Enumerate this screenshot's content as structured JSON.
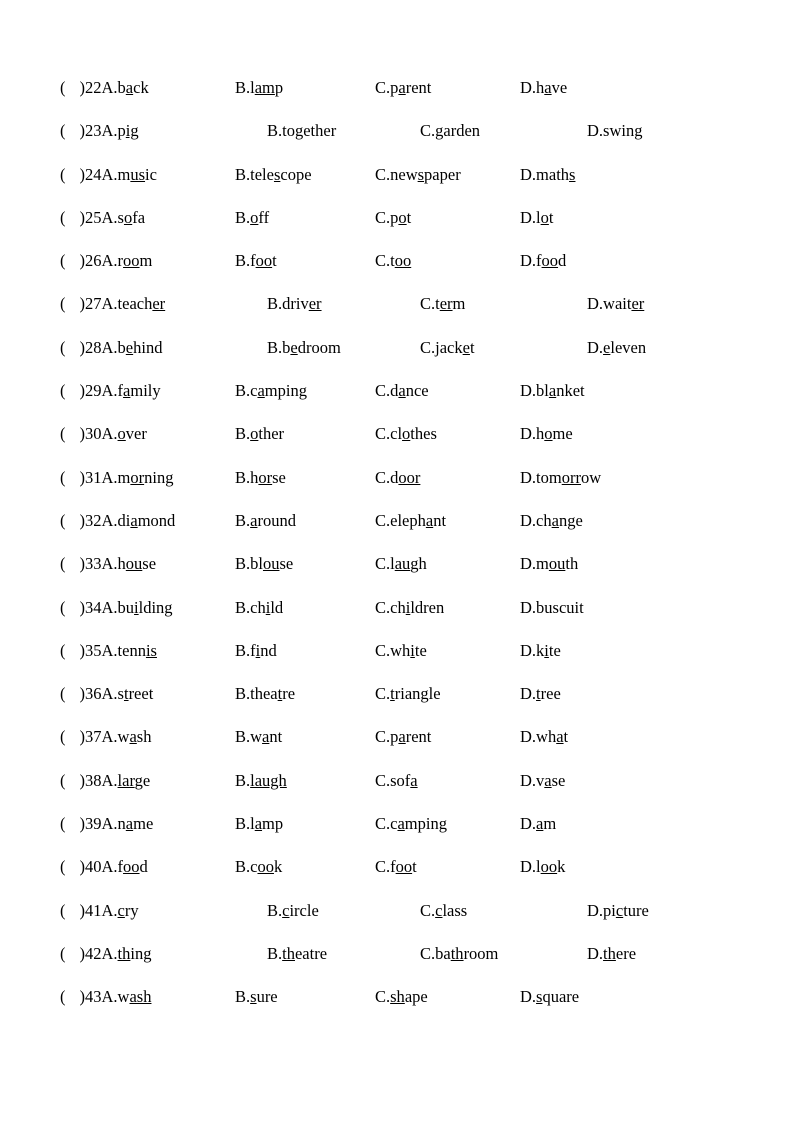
{
  "document": {
    "type": "english-phonetics-worksheet",
    "rows": [
      {
        "num": "22",
        "indent": false,
        "a_pre": "A.b",
        "a_ul": "a",
        "a_post": "ck",
        "b_pre": "B.l",
        "b_ul": "am",
        "b_post": "p",
        "c_pre": "C.p",
        "c_ul": "a",
        "c_post": "rent",
        "d_pre": "D.h",
        "d_ul": "a",
        "d_post": "ve"
      },
      {
        "num": "23",
        "indent": true,
        "a_pre": "A.p",
        "a_ul": "ig",
        "a_post": " ",
        "b_pre": "B.together",
        "b_ul": "",
        "b_post": "",
        "c_pre": "C.garden",
        "c_ul": "",
        "c_post": "",
        "d_pre": "D.swing",
        "d_ul": "",
        "d_post": ""
      },
      {
        "num": "24",
        "indent": false,
        "a_pre": "A.m",
        "a_ul": "us",
        "a_post": "ic",
        "b_pre": "B.tele",
        "b_ul": "s",
        "b_post": "cope",
        "c_pre": "C.new",
        "c_ul": "s",
        "c_post": "paper",
        "d_pre": "D.math",
        "d_ul": "s",
        "d_post": ""
      },
      {
        "num": "25",
        "indent": false,
        "a_pre": "A.s",
        "a_ul": "o",
        "a_post": "fa",
        "b_pre": "B.",
        "b_ul": "o",
        "b_post": "ff",
        "c_pre": "C.p",
        "c_ul": "o",
        "c_post": "t",
        "d_pre": "D.l",
        "d_ul": "o",
        "d_post": "t"
      },
      {
        "num": "26",
        "indent": false,
        "a_pre": "A.r",
        "a_ul": "oo",
        "a_post": "m",
        "b_pre": "B.f",
        "b_ul": "oo",
        "b_post": "t",
        "c_pre": "C.t",
        "c_ul": "oo",
        "c_post": "",
        "d_pre": "D.f",
        "d_ul": "oo",
        "d_post": "d"
      },
      {
        "num": "27",
        "indent": true,
        "a_pre": "A.teach",
        "a_ul": "er",
        "a_post": "",
        "b_pre": "B.driv",
        "b_ul": "er",
        "b_post": "",
        "c_pre": "C.t",
        "c_ul": "er",
        "c_post": "m",
        "d_pre": "D.wait",
        "d_ul": "er",
        "d_post": ""
      },
      {
        "num": "28",
        "indent": true,
        "a_pre": "A.b",
        "a_ul": "e",
        "a_post": "hind",
        "b_pre": "B.b",
        "b_ul": "e",
        "b_post": "droom",
        "c_pre": "C.jack",
        "c_ul": "e",
        "c_post": "t",
        "d_pre": "D.",
        "d_ul": "e",
        "d_post": "leven"
      },
      {
        "num": "29",
        "indent": false,
        "a_pre": "A.f",
        "a_ul": "a",
        "a_post": "mily",
        "b_pre": "B.c",
        "b_ul": "a",
        "b_post": "mping",
        "c_pre": "C.d",
        "c_ul": "a",
        "c_post": "nce",
        "d_pre": "D.bl",
        "d_ul": "a",
        "d_post": "nket"
      },
      {
        "num": "30",
        "indent": false,
        "a_pre": "A.",
        "a_ul": "o",
        "a_post": "ver",
        "b_pre": "B.",
        "b_ul": "o",
        "b_post": "ther",
        "c_pre": "C.cl",
        "c_ul": "o",
        "c_post": "thes",
        "d_pre": "D.h",
        "d_ul": "o",
        "d_post": "me"
      },
      {
        "num": "31",
        "indent": false,
        "a_pre": "A.m",
        "a_ul": "or",
        "a_post": "ning",
        "b_pre": "B.h",
        "b_ul": "or",
        "b_post": "se",
        "c_pre": "C.d",
        "c_ul": "oor",
        "c_post": "",
        "d_pre": "D.tom",
        "d_ul": "orr",
        "d_post": "ow"
      },
      {
        "num": "32",
        "indent": false,
        "a_pre": "A.di",
        "a_ul": "a",
        "a_post": "mond",
        "b_pre": "B.",
        "b_ul": "a",
        "b_post": "round",
        "c_pre": "C.eleph",
        "c_ul": "a",
        "c_post": "nt",
        "d_pre": "D.ch",
        "d_ul": "a",
        "d_post": "nge"
      },
      {
        "num": "33",
        "indent": false,
        "a_pre": "A.h",
        "a_ul": "ou",
        "a_post": "se",
        "b_pre": "B.bl",
        "b_ul": "ou",
        "b_post": "se",
        "c_pre": "C.l",
        "c_ul": "au",
        "c_post": "gh",
        "d_pre": "D.m",
        "d_ul": "ou",
        "d_post": "th"
      },
      {
        "num": "34",
        "indent": false,
        "a_pre": "A.bu",
        "a_ul": "i",
        "a_post": "lding",
        "b_pre": "B.ch",
        "b_ul": "i",
        "b_post": "ld",
        "c_pre": "C.ch",
        "c_ul": "i",
        "c_post": "ldren",
        "d_pre": "D.buscuit",
        "d_ul": "",
        "d_post": ""
      },
      {
        "num": "35",
        "indent": false,
        "a_pre": "A.tenn",
        "a_ul": "is",
        "a_post": "",
        "b_pre": "B.f",
        "b_ul": "i",
        "b_post": "nd",
        "c_pre": "C.wh",
        "c_ul": "i",
        "c_post": "te",
        "d_pre": "D.k",
        "d_ul": "i",
        "d_post": "te"
      },
      {
        "num": "36",
        "indent": false,
        "a_pre": "A.s",
        "a_ul": "t",
        "a_post": "reet",
        "b_pre": "B.thea",
        "b_ul": "t",
        "b_post": "re",
        "c_pre": "C.",
        "c_ul": "t",
        "c_post": "riangle",
        "d_pre": "D.",
        "d_ul": "t",
        "d_post": "ree"
      },
      {
        "num": "37",
        "indent": false,
        "a_pre": "A.w",
        "a_ul": "a",
        "a_post": "sh",
        "b_pre": "B.w",
        "b_ul": "a",
        "b_post": "nt",
        "c_pre": "C.p",
        "c_ul": "a",
        "c_post": "rent",
        "d_pre": "D.wh",
        "d_ul": "a",
        "d_post": "t"
      },
      {
        "num": "38",
        "indent": false,
        "a_pre": "A.",
        "a_ul": "lar",
        "a_post": "ge",
        "b_pre": "B.",
        "b_ul": "laugh",
        "b_post": "",
        "c_pre": "C.sof",
        "c_ul": "a",
        "c_post": "",
        "d_pre": "D.v",
        "d_ul": "a",
        "d_post": "se"
      },
      {
        "num": "39",
        "indent": false,
        "a_pre": "A.n",
        "a_ul": "a",
        "a_post": "me",
        "b_pre": "B.l",
        "b_ul": "a",
        "b_post": "mp",
        "c_pre": "C.c",
        "c_ul": "a",
        "c_post": "mping",
        "d_pre": "D.",
        "d_ul": "a",
        "d_post": "m"
      },
      {
        "num": "40",
        "indent": false,
        "a_pre": "A.f",
        "a_ul": "oo",
        "a_post": "d",
        "b_pre": "B.c",
        "b_ul": "oo",
        "b_post": "k",
        "c_pre": "C.f",
        "c_ul": "oo",
        "c_post": "t",
        "d_pre": "D.l",
        "d_ul": "oo",
        "d_post": "k"
      },
      {
        "num": "41",
        "indent": true,
        "a_pre": "A.",
        "a_ul": "c",
        "a_post": "ry",
        "b_pre": "B.",
        "b_ul": "c",
        "b_post": "ircle",
        "c_pre": "C.",
        "c_ul": "c",
        "c_post": "lass",
        "d_pre": "D.pi",
        "d_ul": "c",
        "d_post": "ture"
      },
      {
        "num": "42",
        "indent": true,
        "a_pre": "A.",
        "a_ul": "th",
        "a_post": "ing",
        "b_pre": "B.",
        "b_ul": "th",
        "b_post": "eatre",
        "c_pre": "C.ba",
        "c_ul": "th",
        "c_post": "room",
        "d_pre": "D.",
        "d_ul": "th",
        "d_post": "ere"
      },
      {
        "num": "43",
        "indent": false,
        "a_pre": "A.w",
        "a_ul": "ash",
        "a_post": "",
        "b_pre": "B.",
        "b_ul": "s",
        "b_post": "ure",
        "c_pre": "C.",
        "c_ul": "sh",
        "c_post": "ape",
        "d_pre": "D.",
        "d_ul": "s",
        "d_post": "quare"
      }
    ],
    "paren_open": "(",
    "paren_close": ")"
  }
}
